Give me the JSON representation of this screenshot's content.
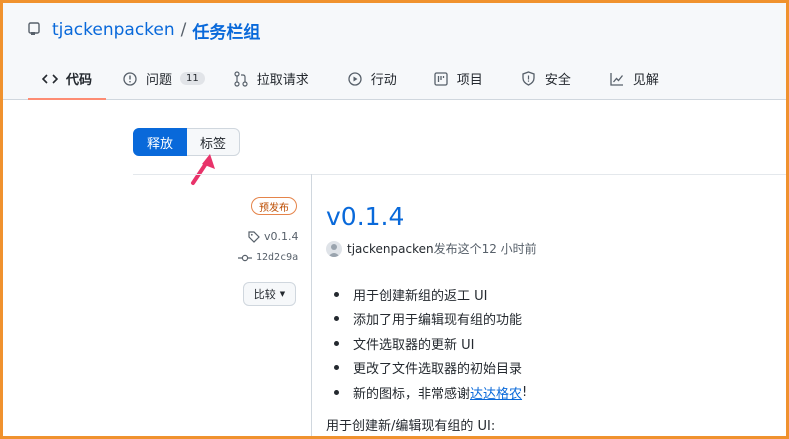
{
  "repo": {
    "owner": "tjackenpacken",
    "separator": "/",
    "name": "任务栏组"
  },
  "tabs": [
    {
      "label": "代码",
      "icon": "code-icon",
      "active": true
    },
    {
      "label": "问题",
      "icon": "issue-icon",
      "count": "11"
    },
    {
      "label": "拉取请求",
      "icon": "pull-request-icon"
    },
    {
      "label": "行动",
      "icon": "play-icon"
    },
    {
      "label": "项目",
      "icon": "project-icon"
    },
    {
      "label": "安全",
      "icon": "shield-icon"
    },
    {
      "label": "见解",
      "icon": "graph-icon"
    }
  ],
  "segment": {
    "releases": "释放",
    "tags": "标签"
  },
  "release": {
    "badge": "预发布",
    "tag": "v0.1.4",
    "commit": "12d2c9a",
    "compare": "比较",
    "title": "v0.1.4",
    "author": "tjackenpacken",
    "published": "发布这个12 小时前",
    "notes": [
      {
        "text": "用于创建新组的返工 UI"
      },
      {
        "text": "添加了用于编辑现有组的功能"
      },
      {
        "text": "文件选取器的更新 UI"
      },
      {
        "text": "更改了文件选取器的初始目录"
      },
      {
        "text": "新的图标，非常感谢",
        "link": "达达格农",
        "suffix": "!"
      }
    ],
    "footer": "用于创建新/编辑现有组的 UI:"
  },
  "colors": {
    "accent": "#0969da",
    "tab_underline": "#fd8c73",
    "frame": "#f0922e",
    "arrow": "#e8336a",
    "prerelease": "#bc4c00"
  }
}
